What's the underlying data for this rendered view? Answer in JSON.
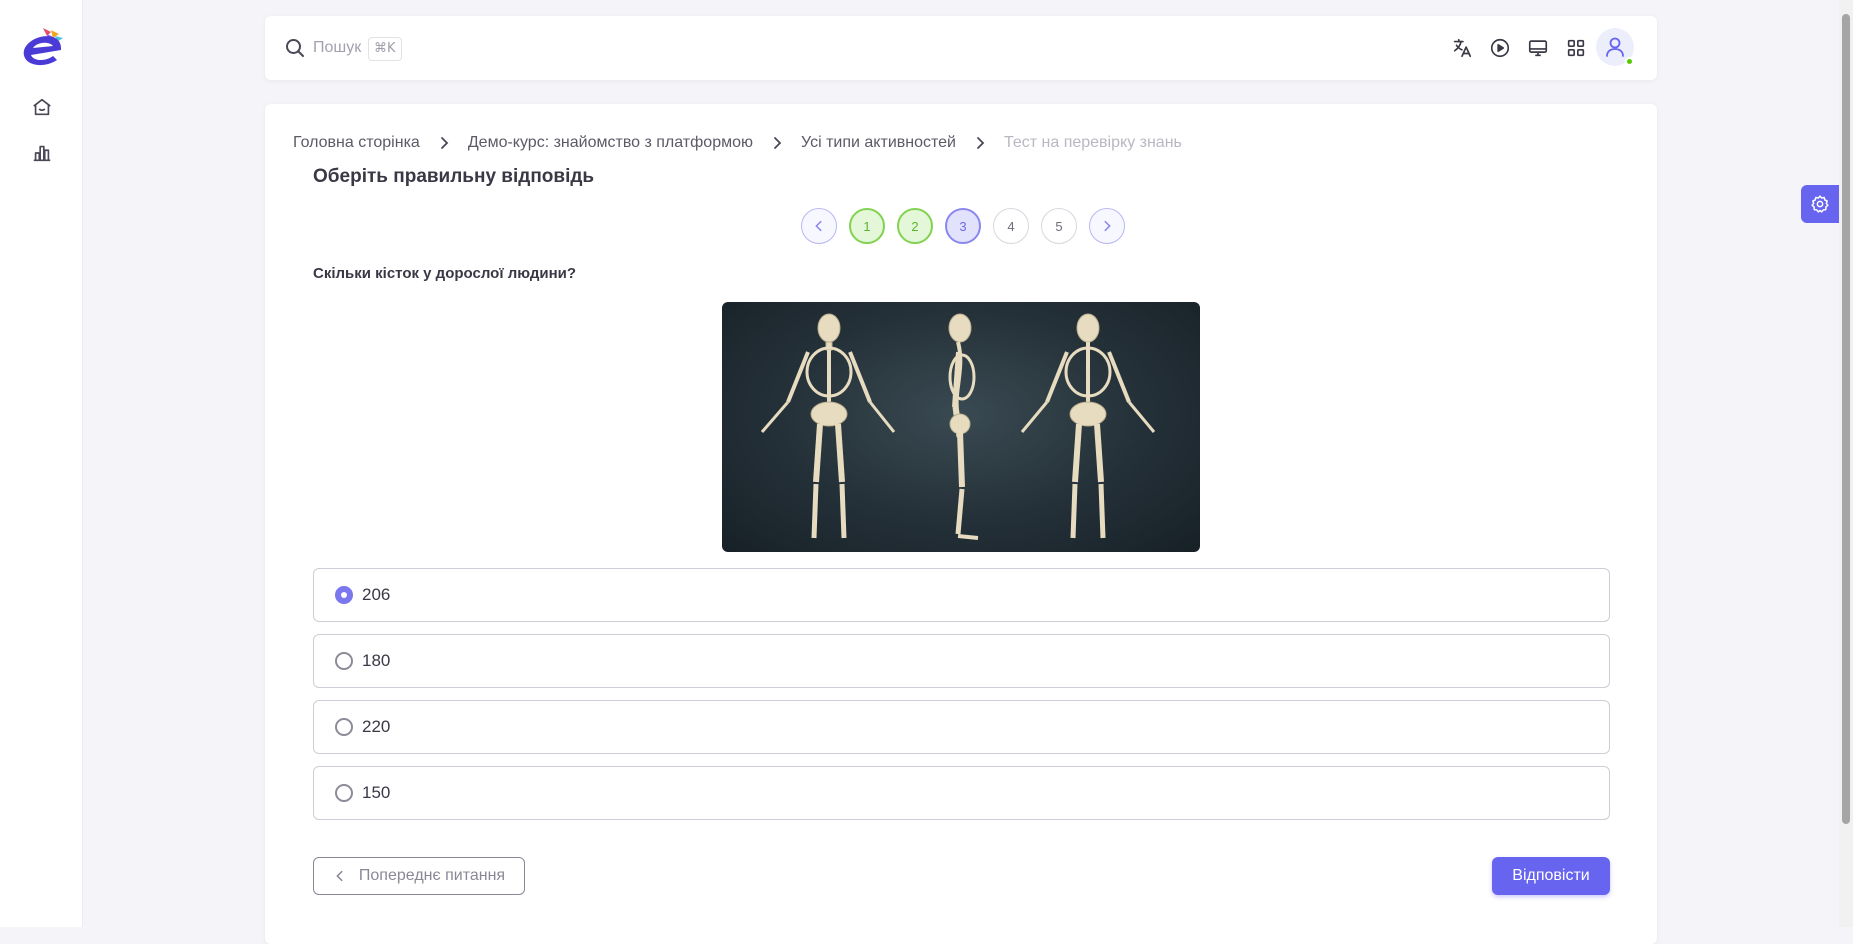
{
  "search": {
    "placeholder": "Пошук",
    "shortcut": "⌘K"
  },
  "topbar_icons": [
    "translate-icon",
    "play-icon",
    "monitor-icon",
    "grid-icon",
    "user-icon"
  ],
  "sidebar": {
    "items": [
      "home-icon",
      "stats-icon"
    ]
  },
  "breadcrumb": [
    "Головна сторінка",
    "Демо-курс: знайомство з платформою",
    "Усі типи активностей",
    "Тест на перевірку знань"
  ],
  "page_title": "Оберіть правильну відповідь",
  "pager": {
    "pages": [
      "1",
      "2",
      "3",
      "4",
      "5"
    ],
    "answered": [
      "1",
      "2"
    ],
    "current": "3"
  },
  "question": "Скільки кісток у дорослої людини?",
  "options": [
    {
      "label": "206",
      "selected": true
    },
    {
      "label": "180",
      "selected": false
    },
    {
      "label": "220",
      "selected": false
    },
    {
      "label": "150",
      "selected": false
    }
  ],
  "buttons": {
    "prev": "Попереднє питання",
    "submit": "Відповісти"
  },
  "colors": {
    "accent": "#6764f0",
    "answered": "#80d24f",
    "online": "#56ca00"
  }
}
